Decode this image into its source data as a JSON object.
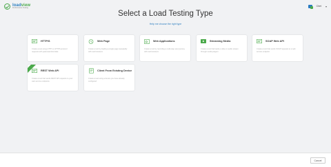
{
  "header": {
    "logo_name_a": "load",
    "logo_name_b": "view",
    "logo_sub": "Performance Testing",
    "user_name": "Chet",
    "user_chevron": "▾"
  },
  "page": {
    "title": "Select a Load Testing Type",
    "help_link": "Help me choose the right type"
  },
  "cards": [
    {
      "title": "HTTP/S",
      "description": "Create a test using HTTP or HTTPS protocol requests with parameterized data",
      "icon": "http-icon"
    },
    {
      "title": "Web Page",
      "description": "Create a test by loading a single page repeatedly with real browsers",
      "icon": "web-page-icon"
    },
    {
      "title": "Web Applications",
      "description": "Create a test by recording a multi-step user journey with real browsers",
      "icon": "web-app-icon"
    },
    {
      "title": "Streaming Media",
      "description": "Create a test that loads a video or audio stream through media players",
      "icon": "streaming-icon"
    },
    {
      "title": "SOAP Web API",
      "description": "Create a test that sends SOAP requests to a web service endpoint",
      "icon": "soap-api-icon"
    },
    {
      "title": "REST Web API",
      "description": "Create a test that sends REST API requests to your web service endpoints",
      "icon": "rest-api-icon"
    },
    {
      "title": "Client From Existing Device",
      "description": "Create a test using a device you have already configured",
      "icon": "device-icon"
    }
  ],
  "footer": {
    "cancel_label": "Cancel"
  },
  "colors": {
    "brand_blue": "#2a7cbf",
    "brand_green": "#4aa94a",
    "background": "#f1f2f4"
  }
}
